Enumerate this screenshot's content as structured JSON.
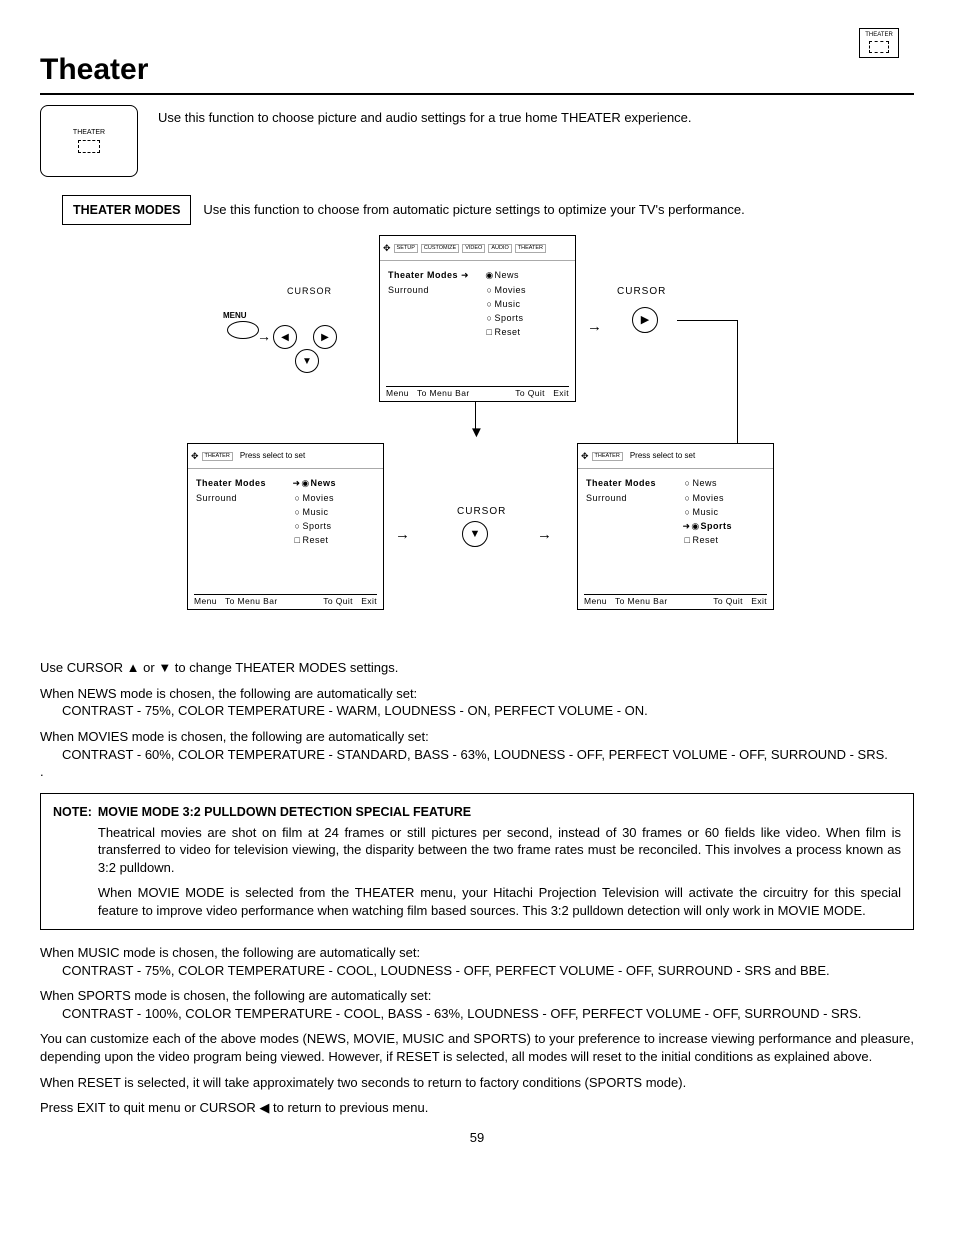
{
  "header": {
    "title": "Theater",
    "badge_label": "THEATER"
  },
  "intro": "Use this function to choose picture and audio settings for a true home THEATER experience.",
  "theater_box_label": "THEATER",
  "modes": {
    "label": "THEATER MODES",
    "desc": "Use this function to choose from automatic picture settings to optimize your TV's performance."
  },
  "diagram": {
    "cursor": "CURSOR",
    "menu": "MENU",
    "tabs": [
      "SETUP",
      "CUSTOMIZE",
      "VIDEO",
      "AUDIO",
      "THEATER"
    ],
    "press_select": "Press select to set",
    "theater_lbl": "THEATER",
    "menu_items_left": [
      "Theater Modes",
      "Surround"
    ],
    "menu_items_right": [
      "News",
      "Movies",
      "Music",
      "Sports",
      "Reset"
    ],
    "footer_left": "Menu",
    "footer_mid": "To Menu Bar",
    "footer_q": "To Quit",
    "footer_exit": "Exit"
  },
  "post_diagram": "Use CURSOR ▲ or ▼ to change THEATER MODES settings.",
  "news_mode": {
    "lead": "When NEWS mode is chosen, the following are automatically set:",
    "detail": "CONTRAST - 75%, COLOR TEMPERATURE - WARM, LOUDNESS - ON, PERFECT VOLUME - ON."
  },
  "movies_mode": {
    "lead": "When MOVIES mode is chosen, the following are automatically set:",
    "detail": "CONTRAST - 60%, COLOR TEMPERATURE - STANDARD, BASS - 63%, LOUDNESS - OFF, PERFECT VOLUME - OFF, SURROUND - SRS."
  },
  "note": {
    "label": "NOTE:",
    "heading": "MOVIE MODE 3:2 PULLDOWN DETECTION SPECIAL FEATURE",
    "p1": "Theatrical movies are shot on film at 24 frames or still pictures per second, instead of 30 frames or 60 fields like video. When film is transferred to video for television viewing, the disparity between the two frame rates must be reconciled. This involves a process known as 3:2 pulldown.",
    "p2": "When MOVIE MODE is selected from the THEATER menu, your Hitachi Projection Television will activate the circuitry for this special feature to improve video performance when watching film based sources. This 3:2 pulldown detection will only work in MOVIE MODE."
  },
  "music_mode": {
    "lead": "When MUSIC mode is chosen, the following are automatically set:",
    "detail": "CONTRAST - 75%, COLOR TEMPERATURE - COOL, LOUDNESS - OFF, PERFECT VOLUME - OFF, SURROUND - SRS and BBE."
  },
  "sports_mode": {
    "lead": "When SPORTS mode is chosen, the following are automatically set:",
    "detail": "CONTRAST - 100%, COLOR TEMPERATURE - COOL, BASS - 63%, LOUDNESS - OFF, PERFECT VOLUME - OFF, SURROUND - SRS."
  },
  "customize": "You can customize each of the above modes (NEWS, MOVIE, MUSIC and SPORTS) to your preference to increase viewing performance and pleasure, depending upon the video program being viewed. However, if RESET is selected, all modes will reset to the initial conditions as explained above.",
  "reset_note": "When RESET is selected, it will take approximately two seconds to return to factory conditions (SPORTS mode).",
  "exit_note": "Press EXIT to quit menu or CURSOR ◀ to return to previous menu.",
  "page": "59"
}
